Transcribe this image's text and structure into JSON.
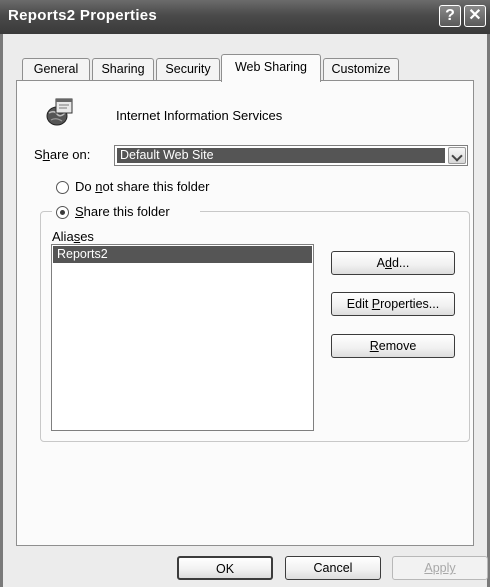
{
  "window": {
    "title": "Reports2 Properties",
    "help_glyph": "?",
    "close_glyph": "✕"
  },
  "tabs": [
    {
      "label": "General",
      "active": false
    },
    {
      "label": "Sharing",
      "active": false
    },
    {
      "label": "Security",
      "active": false
    },
    {
      "label": "Web Sharing",
      "active": true
    },
    {
      "label": "Customize",
      "active": false
    }
  ],
  "header": {
    "icon": "iis-globe-icon",
    "label": "Internet Information Services"
  },
  "share_on": {
    "label_pre": "S",
    "label_mnemonic": "h",
    "label_post": "are on:",
    "value": "Default Web Site"
  },
  "options": {
    "do_not_share": {
      "pre": "Do ",
      "mnemonic": "n",
      "post": "ot share this folder",
      "checked": false
    },
    "share": {
      "pre": "",
      "mnemonic": "S",
      "post": "hare this folder",
      "checked": true
    }
  },
  "aliases": {
    "label_pre": "Alia",
    "label_mnemonic": "s",
    "label_post": "es",
    "items": [
      "Reports2"
    ],
    "selected_index": 0
  },
  "actions": {
    "add": {
      "pre": "A",
      "mnemonic": "d",
      "post": "d..."
    },
    "edit": {
      "pre": "Edit ",
      "mnemonic": "P",
      "post": "roperties..."
    },
    "remove": {
      "pre": "",
      "mnemonic": "R",
      "post": "emove"
    }
  },
  "footer": {
    "ok": "OK",
    "cancel": "Cancel",
    "apply": "Apply",
    "apply_enabled": false
  }
}
